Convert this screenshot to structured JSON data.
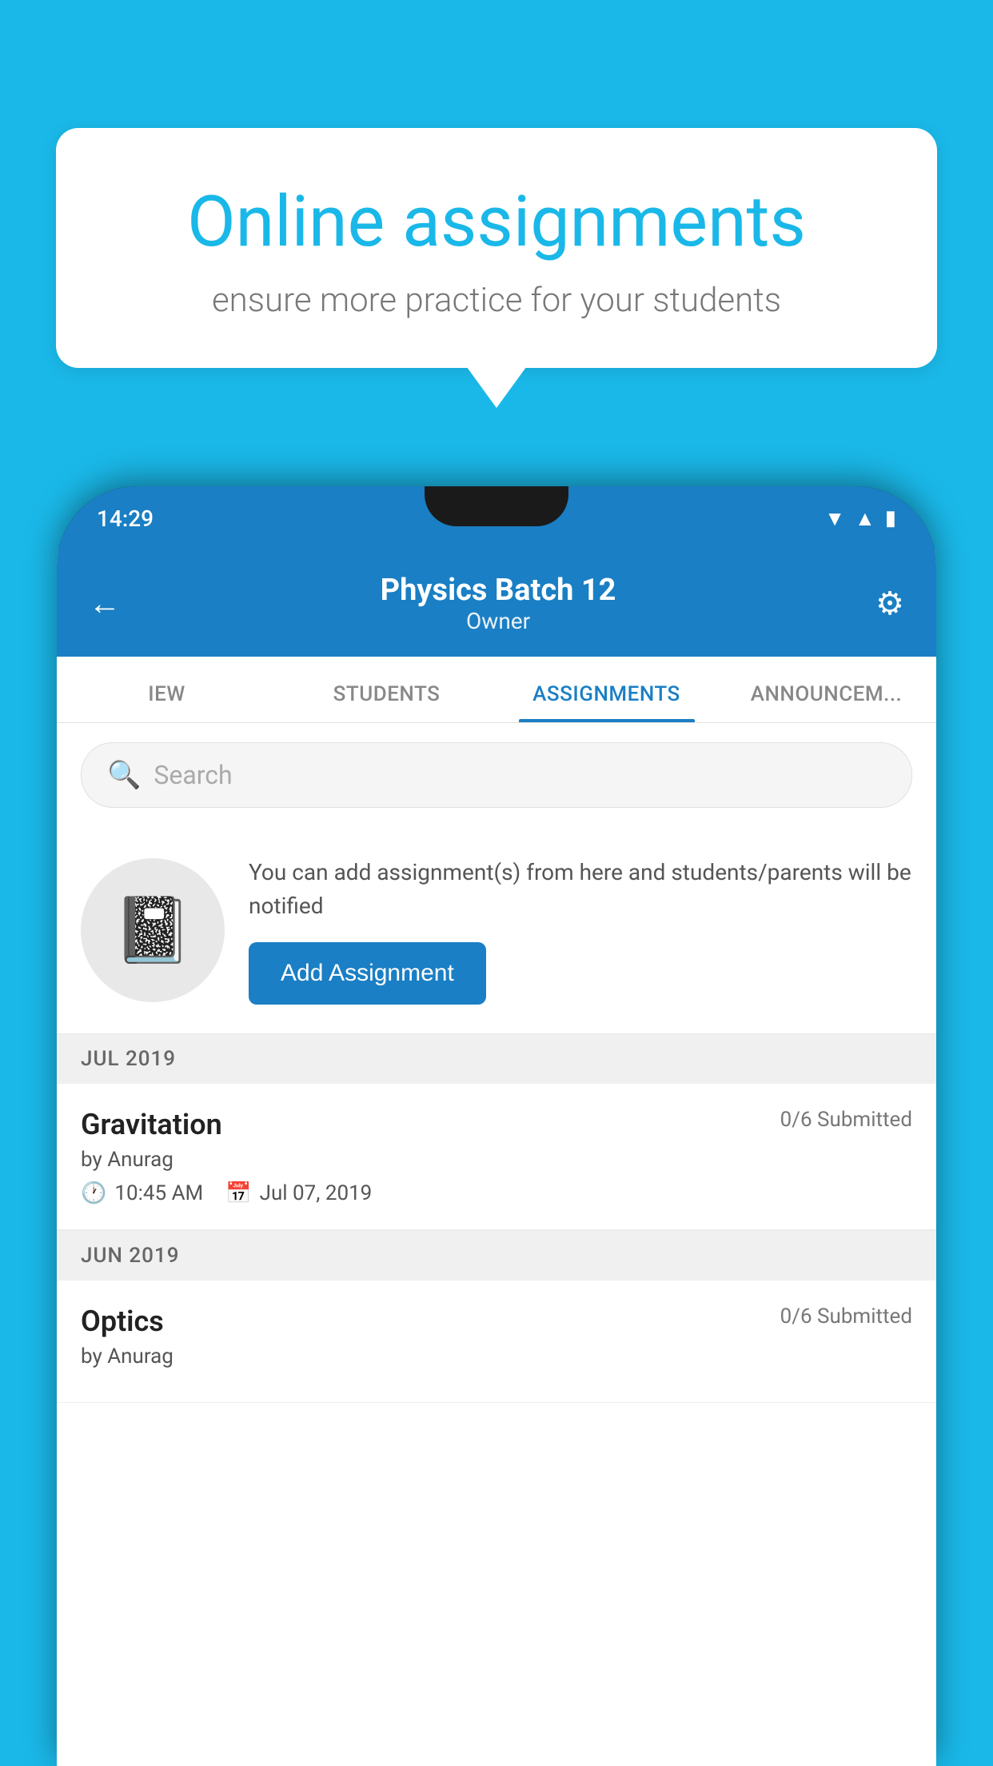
{
  "background_color": "#1ab8e8",
  "speech_bubble": {
    "title": "Online assignments",
    "subtitle": "ensure more practice for your students"
  },
  "phone": {
    "status_bar": {
      "time": "14:29"
    },
    "header": {
      "title": "Physics Batch 12",
      "subtitle": "Owner"
    },
    "tabs": [
      {
        "label": "IEW",
        "active": false
      },
      {
        "label": "STUDENTS",
        "active": false
      },
      {
        "label": "ASSIGNMENTS",
        "active": true
      },
      {
        "label": "ANNOUNCEM...",
        "active": false
      }
    ],
    "search": {
      "placeholder": "Search"
    },
    "info_card": {
      "text": "You can add assignment(s) from here and students/parents will be notified",
      "button_label": "Add Assignment"
    },
    "sections": [
      {
        "label": "JUL 2019",
        "assignments": [
          {
            "name": "Gravitation",
            "submitted": "0/6 Submitted",
            "author": "by Anurag",
            "time": "10:45 AM",
            "date": "Jul 07, 2019"
          }
        ]
      },
      {
        "label": "JUN 2019",
        "assignments": [
          {
            "name": "Optics",
            "submitted": "0/6 Submitted",
            "author": "by Anurag",
            "time": "",
            "date": ""
          }
        ]
      }
    ]
  }
}
